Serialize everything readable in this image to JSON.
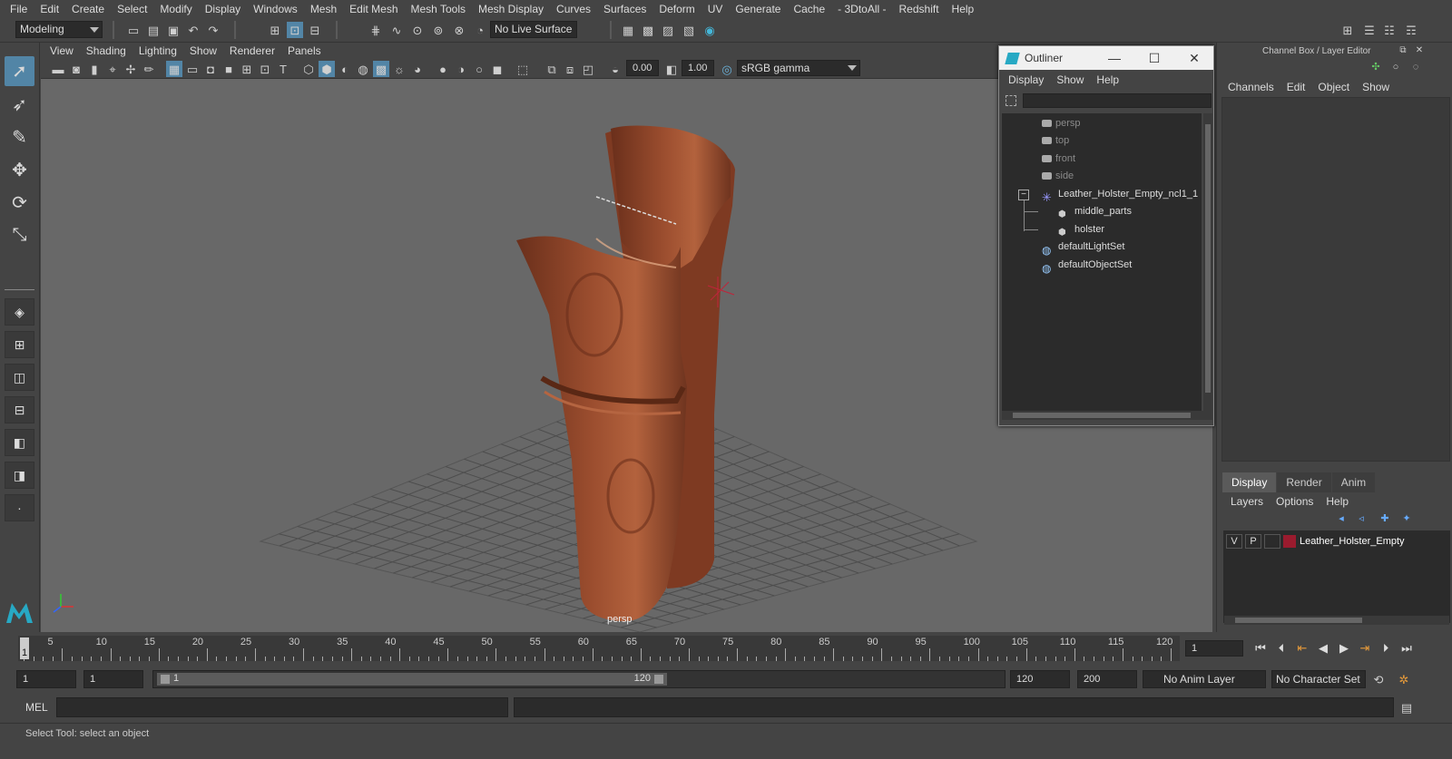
{
  "menubar": {
    "items": [
      "File",
      "Edit",
      "Create",
      "Select",
      "Modify",
      "Display",
      "Windows",
      "Mesh",
      "Edit Mesh",
      "Mesh Tools",
      "Mesh Display",
      "Curves",
      "Surfaces",
      "Deform",
      "UV",
      "Generate",
      "Cache",
      "- 3DtoAll -",
      "Redshift",
      "Help"
    ]
  },
  "shelf": {
    "mode": "Modeling",
    "live_surface": "No Live Surface"
  },
  "viewport": {
    "menu": [
      "View",
      "Shading",
      "Lighting",
      "Show",
      "Renderer",
      "Panels"
    ],
    "exposure": "0.00",
    "gamma": "1.00",
    "colorspace": "sRGB gamma",
    "camera_label": "persp"
  },
  "outliner": {
    "title": "Outliner",
    "menu": [
      "Display",
      "Show",
      "Help"
    ],
    "items": [
      {
        "label": "persp",
        "dim": true
      },
      {
        "label": "top",
        "dim": true
      },
      {
        "label": "front",
        "dim": true
      },
      {
        "label": "side",
        "dim": true
      },
      {
        "label": "Leather_Holster_Empty_ncl1_1",
        "dim": false
      },
      {
        "label": "middle_parts",
        "dim": false
      },
      {
        "label": "holster",
        "dim": false
      },
      {
        "label": "defaultLightSet",
        "dim": false
      },
      {
        "label": "defaultObjectSet",
        "dim": false
      }
    ]
  },
  "channelbox": {
    "title": "Channel Box / Layer Editor",
    "menu": [
      "Channels",
      "Edit",
      "Object",
      "Show"
    ],
    "tabs": [
      "Display",
      "Render",
      "Anim"
    ],
    "layer_menu": [
      "Layers",
      "Options",
      "Help"
    ],
    "layer": {
      "v": "V",
      "p": "P",
      "name": "Leather_Holster_Empty",
      "color": "#9a1b2e"
    }
  },
  "timeline": {
    "ticks": [
      "5",
      "10",
      "15",
      "20",
      "25",
      "30",
      "35",
      "40",
      "45",
      "50",
      "55",
      "60",
      "65",
      "70",
      "75",
      "80",
      "85",
      "90",
      "95",
      "100",
      "105",
      "110",
      "115",
      "120"
    ],
    "start_tick": "1",
    "current_frame": "1"
  },
  "range": {
    "start": "1",
    "playback_start": "1",
    "slider_start": "1",
    "slider_end": "120",
    "playback_end": "120",
    "end": "200",
    "anim_layer": "No Anim Layer",
    "char_set": "No Character Set"
  },
  "cmdline": {
    "label": "MEL"
  },
  "status": {
    "text": "Select Tool: select an object"
  }
}
